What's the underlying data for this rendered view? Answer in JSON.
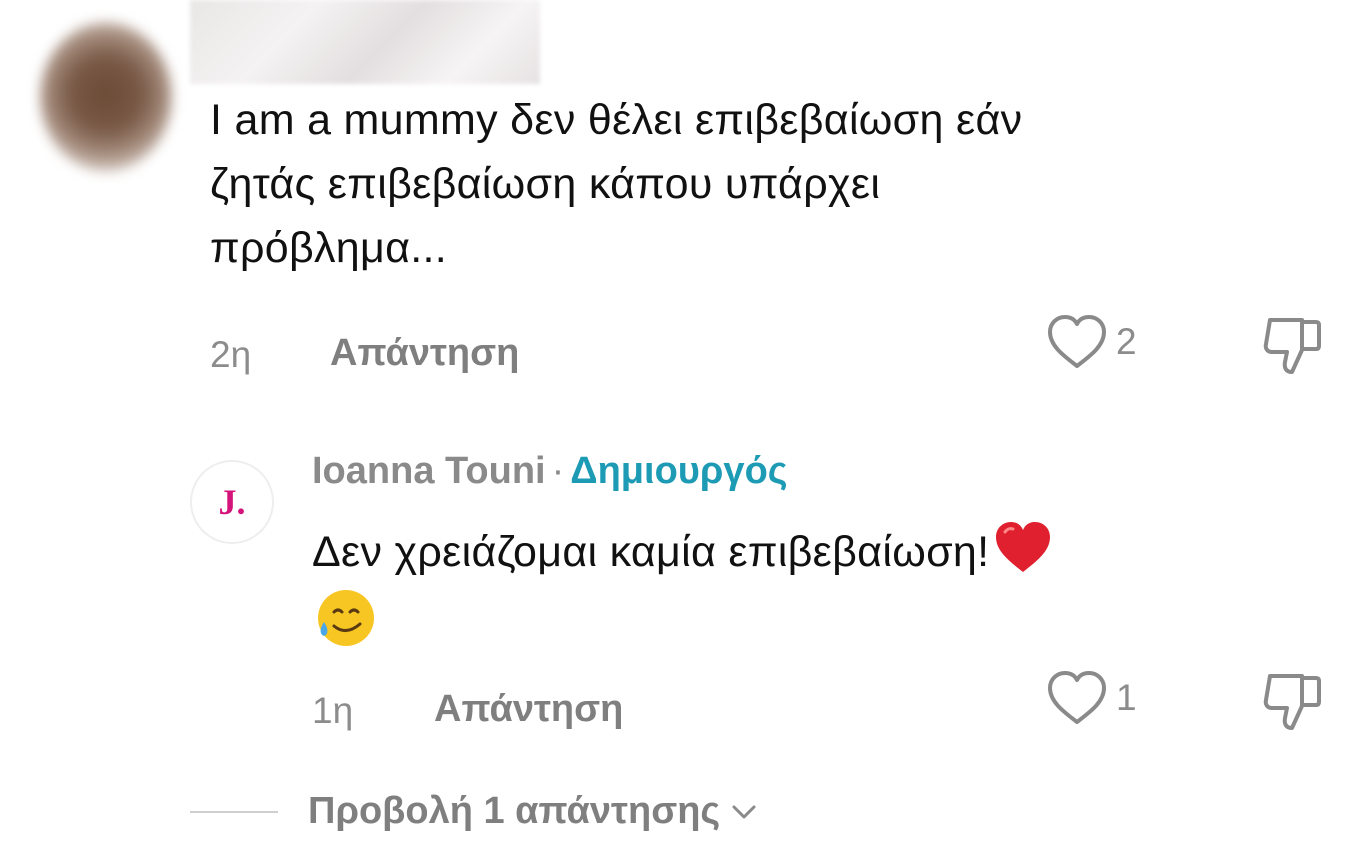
{
  "comment1": {
    "text_lines": [
      "I am a mummy δεν θέλει επιβεβαίωση εάν",
      "ζητάς επιβεβαίωση κάπου υπάρχει",
      "πρόβλημα..."
    ],
    "time": "2η",
    "reply_label": "Απάντηση",
    "likes": "2"
  },
  "reply": {
    "avatar_letter": "J.",
    "author": "Ioanna Touni",
    "separator": "·",
    "badge": "Δημιουργός",
    "text": "Δεν χρειάζομαι καμία επιβεβαίωση!",
    "emoji_1": "heart-emoji",
    "emoji_2": "smiling-face-with-tear-emoji",
    "time": "1η",
    "reply_label": "Απάντηση",
    "likes": "1"
  },
  "view_replies": {
    "label": "Προβολή 1 απάντησης"
  },
  "colors": {
    "text": "#111111",
    "muted": "#8c8c8c",
    "creator_badge": "#1d9bb5",
    "avatar_letter": "#d4147a",
    "heart_emoji": "#e0202e"
  },
  "icons": [
    "heart-outline-icon",
    "thumbs-down-icon",
    "chevron-down-icon"
  ]
}
